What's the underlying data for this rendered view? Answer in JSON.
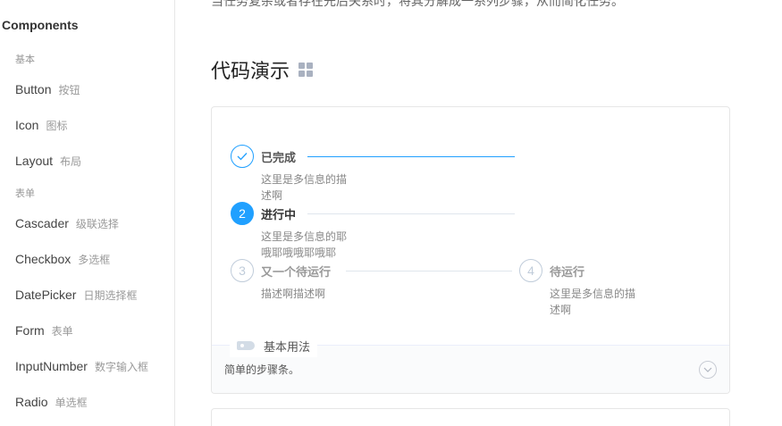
{
  "top_text": "当任务复杂或者存在先后关系时，将其分解成一系列步骤，从而简化任务。",
  "sidebar": {
    "title": "Components",
    "groups": [
      {
        "label": "基本"
      },
      {
        "label": "表单"
      }
    ],
    "items": [
      {
        "en": "Button",
        "zh": "按钮"
      },
      {
        "en": "Icon",
        "zh": "图标"
      },
      {
        "en": "Layout",
        "zh": "布局"
      },
      {
        "en": "Cascader",
        "zh": "级联选择"
      },
      {
        "en": "Checkbox",
        "zh": "多选框"
      },
      {
        "en": "DatePicker",
        "zh": "日期选择框"
      },
      {
        "en": "Form",
        "zh": "表单"
      },
      {
        "en": "InputNumber",
        "zh": "数字输入框"
      },
      {
        "en": "Radio",
        "zh": "单选框"
      }
    ]
  },
  "section": {
    "title": "代码演示",
    "icon": "grid-icon"
  },
  "steps": [
    {
      "status": "finish",
      "icon": "check-icon",
      "title": "已完成",
      "desc": "这里是多信息的描述啊"
    },
    {
      "status": "process",
      "number": "2",
      "title": "进行中",
      "desc": "这里是多信息的耶哦耶哦哦耶哦耶"
    },
    {
      "status": "wait",
      "number": "3",
      "title": "又一个待运行",
      "desc": "描述啊描述啊"
    },
    {
      "status": "wait",
      "number": "4",
      "title": "待运行",
      "desc": "这里是多信息的描述啊"
    }
  ],
  "meta": {
    "tag_label": "基本用法",
    "description": "简单的步骤条。",
    "expand_icon": "chevron-down-circle-icon"
  },
  "colors": {
    "accent": "#20a0ff",
    "finish_line": "#20a0ff",
    "wait_line": "#e0e6ed"
  }
}
